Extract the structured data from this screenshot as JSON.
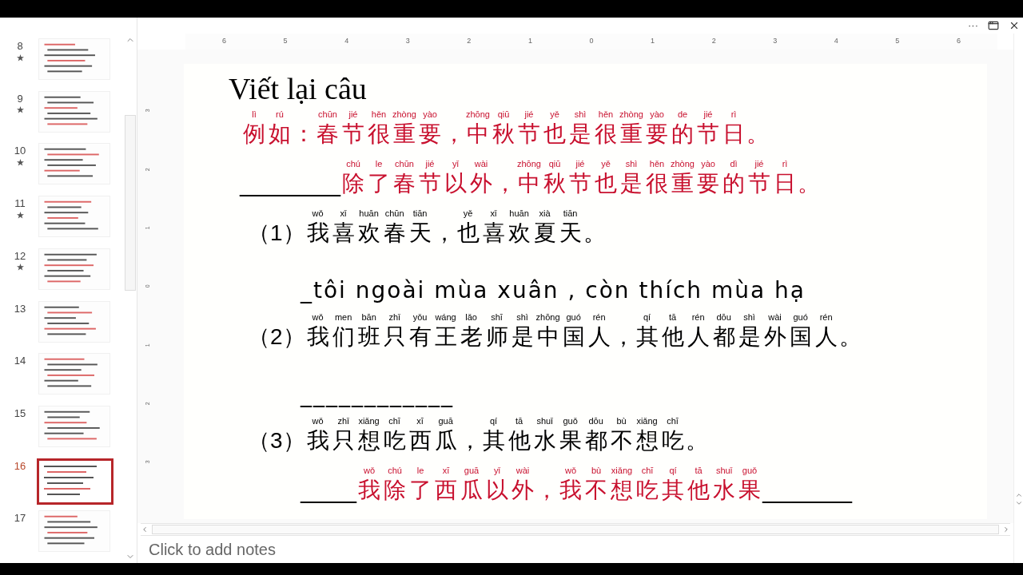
{
  "slides_panel": {
    "thumbnails": [
      {
        "number": "8",
        "starred": true,
        "selected": false
      },
      {
        "number": "9",
        "starred": true,
        "selected": false
      },
      {
        "number": "10",
        "starred": true,
        "selected": false
      },
      {
        "number": "11",
        "starred": true,
        "selected": false
      },
      {
        "number": "12",
        "starred": true,
        "selected": false
      },
      {
        "number": "13",
        "starred": false,
        "selected": false
      },
      {
        "number": "14",
        "starred": false,
        "selected": false
      },
      {
        "number": "15",
        "starred": false,
        "selected": false
      },
      {
        "number": "16",
        "starred": false,
        "selected": true
      },
      {
        "number": "17",
        "starred": false,
        "selected": false
      }
    ]
  },
  "window_controls": [
    "···"
  ],
  "ruler": {
    "horizontal": [
      "6",
      "5",
      "4",
      "3",
      "2",
      "1",
      "0",
      "1",
      "2",
      "3",
      "4",
      "5",
      "6"
    ],
    "vertical": [
      "3",
      "2",
      "1",
      "0",
      "1",
      "2",
      "3"
    ]
  },
  "slide": {
    "title": "Viết lại câu",
    "lines": [
      {
        "kind": "example",
        "segments": [
          {
            "text": "例",
            "pinyin": "lì"
          },
          {
            "text": "如",
            "pinyin": "rú"
          },
          {
            "text": "："
          },
          {
            "text": "春",
            "pinyin": "chūn"
          },
          {
            "text": "节",
            "pinyin": "jié"
          },
          {
            "text": "很",
            "pinyin": "hěn"
          },
          {
            "text": "重",
            "pinyin": "zhòng"
          },
          {
            "text": "要",
            "pinyin": "yào"
          },
          {
            "text": "，"
          },
          {
            "text": "中",
            "pinyin": "zhōng"
          },
          {
            "text": "秋",
            "pinyin": "qiū"
          },
          {
            "text": "节",
            "pinyin": "jié"
          },
          {
            "text": "也",
            "pinyin": "yě"
          },
          {
            "text": "是",
            "pinyin": "shì"
          },
          {
            "text": "很",
            "pinyin": "hěn"
          },
          {
            "text": "重",
            "pinyin": "zhòng"
          },
          {
            "text": "要",
            "pinyin": "yào"
          },
          {
            "text": "的",
            "pinyin": "de"
          },
          {
            "text": "节",
            "pinyin": "jié"
          },
          {
            "text": "日",
            "pinyin": "rì"
          },
          {
            "text": "。"
          }
        ]
      },
      {
        "kind": "answer",
        "segments": [
          {
            "kind": "blank",
            "text": "_________"
          },
          {
            "text": "除",
            "pinyin": "chú"
          },
          {
            "text": "了",
            "pinyin": "le"
          },
          {
            "text": "春",
            "pinyin": "chūn"
          },
          {
            "text": "节",
            "pinyin": "jié"
          },
          {
            "text": "以",
            "pinyin": "yǐ"
          },
          {
            "text": "外",
            "pinyin": "wài"
          },
          {
            "text": "，"
          },
          {
            "text": "中",
            "pinyin": "zhōng"
          },
          {
            "text": "秋",
            "pinyin": "qiū"
          },
          {
            "text": "节",
            "pinyin": "jié"
          },
          {
            "text": "也",
            "pinyin": "yě"
          },
          {
            "text": "是",
            "pinyin": "shì"
          },
          {
            "text": "很",
            "pinyin": "hěn"
          },
          {
            "text": "重",
            "pinyin": "zhòng"
          },
          {
            "text": "要",
            "pinyin": "yào"
          },
          {
            "text": "的",
            "pinyin": "dì"
          },
          {
            "text": "节",
            "pinyin": "jié"
          },
          {
            "text": "日",
            "pinyin": "rì"
          },
          {
            "text": "。"
          }
        ]
      },
      {
        "kind": "question",
        "segments": [
          {
            "text": "（1）"
          },
          {
            "text": "我",
            "pinyin": "wǒ"
          },
          {
            "text": "喜",
            "pinyin": "xǐ"
          },
          {
            "text": "欢",
            "pinyin": "huān"
          },
          {
            "text": "春",
            "pinyin": "chūn"
          },
          {
            "text": "天",
            "pinyin": "tiān"
          },
          {
            "text": "，"
          },
          {
            "text": "也",
            "pinyin": "yě"
          },
          {
            "text": "喜",
            "pinyin": "xǐ"
          },
          {
            "text": "欢",
            "pinyin": "huān"
          },
          {
            "text": "夏",
            "pinyin": "xià"
          },
          {
            "text": "天",
            "pinyin": "tiān"
          },
          {
            "text": "。"
          }
        ]
      },
      {
        "kind": "note",
        "segments": [
          {
            "text": "_tôi ngoài mùa xuân , còn thích mùa hạ"
          }
        ]
      },
      {
        "kind": "question",
        "segments": [
          {
            "text": "（2）"
          },
          {
            "text": "我",
            "pinyin": "wǒ"
          },
          {
            "text": "们",
            "pinyin": "men"
          },
          {
            "text": "班",
            "pinyin": "bān"
          },
          {
            "text": "只",
            "pinyin": "zhǐ"
          },
          {
            "text": "有",
            "pinyin": "yǒu"
          },
          {
            "text": "王",
            "pinyin": "wáng"
          },
          {
            "text": "老",
            "pinyin": "lǎo"
          },
          {
            "text": "师",
            "pinyin": "shī"
          },
          {
            "text": "是",
            "pinyin": "shì"
          },
          {
            "text": "中",
            "pinyin": "zhōng"
          },
          {
            "text": "国",
            "pinyin": "guó"
          },
          {
            "text": "人",
            "pinyin": "rén"
          },
          {
            "text": "，"
          },
          {
            "text": "其",
            "pinyin": "qí"
          },
          {
            "text": "他",
            "pinyin": "tā"
          },
          {
            "text": "人",
            "pinyin": "rén"
          },
          {
            "text": "都",
            "pinyin": "dōu"
          },
          {
            "text": "是",
            "pinyin": "shì"
          },
          {
            "text": "外",
            "pinyin": "wài"
          },
          {
            "text": "国",
            "pinyin": "guó"
          },
          {
            "text": "人",
            "pinyin": "rén"
          },
          {
            "text": "。"
          }
        ]
      },
      {
        "kind": "note",
        "segments": [
          {
            "kind": "blank",
            "text": "____________"
          }
        ]
      },
      {
        "kind": "question",
        "segments": [
          {
            "text": "（3）"
          },
          {
            "text": "我",
            "pinyin": "wǒ"
          },
          {
            "text": "只",
            "pinyin": "zhǐ"
          },
          {
            "text": "想",
            "pinyin": "xiǎng"
          },
          {
            "text": "吃",
            "pinyin": "chī"
          },
          {
            "text": "西",
            "pinyin": "xī"
          },
          {
            "text": "瓜",
            "pinyin": "guā"
          },
          {
            "text": "，"
          },
          {
            "text": "其",
            "pinyin": "qí"
          },
          {
            "text": "他",
            "pinyin": "tā"
          },
          {
            "text": "水",
            "pinyin": "shuǐ"
          },
          {
            "text": "果",
            "pinyin": "guǒ"
          },
          {
            "text": "都",
            "pinyin": "dōu"
          },
          {
            "text": "不",
            "pinyin": "bù"
          },
          {
            "text": "想",
            "pinyin": "xiǎng"
          },
          {
            "text": "吃",
            "pinyin": "chī"
          },
          {
            "text": "。"
          }
        ]
      },
      {
        "kind": "answer",
        "segments": [
          {
            "kind": "blank",
            "text": "_____"
          },
          {
            "text": "我",
            "pinyin": "wǒ"
          },
          {
            "text": "除",
            "pinyin": "chú"
          },
          {
            "text": "了",
            "pinyin": "le"
          },
          {
            "text": "西",
            "pinyin": "xī"
          },
          {
            "text": "瓜",
            "pinyin": "guā"
          },
          {
            "text": "以",
            "pinyin": "yǐ"
          },
          {
            "text": "外",
            "pinyin": "wài"
          },
          {
            "text": "，"
          },
          {
            "text": "我",
            "pinyin": "wǒ"
          },
          {
            "text": "不",
            "pinyin": "bù"
          },
          {
            "text": "想",
            "pinyin": "xiǎng"
          },
          {
            "text": "吃",
            "pinyin": "chī"
          },
          {
            "text": "其",
            "pinyin": "qí"
          },
          {
            "text": "他",
            "pinyin": "tā"
          },
          {
            "text": "水",
            "pinyin": "shuǐ"
          },
          {
            "text": "果",
            "pinyin": "guǒ"
          },
          {
            "kind": "blank",
            "text": "________"
          }
        ]
      }
    ]
  },
  "notes": {
    "placeholder": "Click to add notes"
  }
}
